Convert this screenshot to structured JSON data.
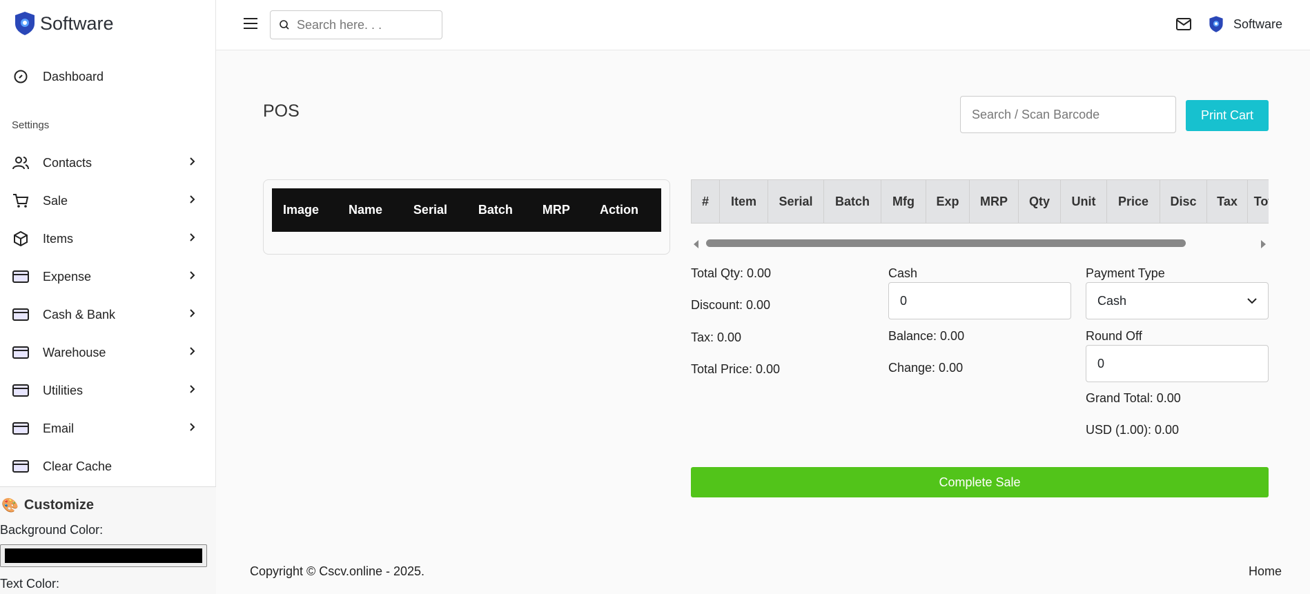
{
  "brand": {
    "name": "Software"
  },
  "sidebar": {
    "dashboard": "Dashboard",
    "section": "Settings",
    "items": [
      {
        "label": "Contacts",
        "icon": "users-icon"
      },
      {
        "label": "Sale",
        "icon": "cart-icon"
      },
      {
        "label": "Items",
        "icon": "box-icon"
      },
      {
        "label": "Expense",
        "icon": "card-icon"
      },
      {
        "label": "Cash & Bank",
        "icon": "card-icon"
      },
      {
        "label": "Warehouse",
        "icon": "card-icon"
      },
      {
        "label": "Utilities",
        "icon": "card-icon"
      },
      {
        "label": "Email",
        "icon": "card-icon"
      }
    ],
    "clear_cache": "Clear Cache",
    "customize": {
      "title": "Customize",
      "bg_label": "Background Color:",
      "bg_value": "#000000",
      "text_label": "Text Color:"
    }
  },
  "header": {
    "search_placeholder": "Search here. . .",
    "user": "Software"
  },
  "page": {
    "title": "POS",
    "barcode_placeholder": "Search / Scan Barcode",
    "print_cart": "Print Cart"
  },
  "items_table": {
    "columns": [
      "Image",
      "Name",
      "Serial",
      "Batch",
      "MRP",
      "Action"
    ]
  },
  "cart_table": {
    "columns": [
      "#",
      "Item",
      "Serial",
      "Batch",
      "Mfg",
      "Exp",
      "MRP",
      "Qty",
      "Unit",
      "Price",
      "Disc",
      "Tax",
      "Total"
    ]
  },
  "summary": {
    "total_qty": "Total Qty: 0.00",
    "discount": "Discount: 0.00",
    "tax": "Tax: 0.00",
    "total_price": "Total Price: 0.00",
    "cash_label": "Cash",
    "cash_value": "0",
    "balance": "Balance: 0.00",
    "change": "Change: 0.00",
    "payment_label": "Payment Type",
    "payment_value": "Cash",
    "round_label": "Round Off",
    "round_value": "0",
    "grand_total": "Grand Total: 0.00",
    "usd": "USD (1.00): 0.00"
  },
  "complete_sale": "Complete Sale",
  "footer": {
    "copyright": "Copyright © Cscv.online - 2025.",
    "home": "Home"
  },
  "colors": {
    "accent": "#17c1cf",
    "success": "#52c41a",
    "brand": "#2a47b8"
  }
}
